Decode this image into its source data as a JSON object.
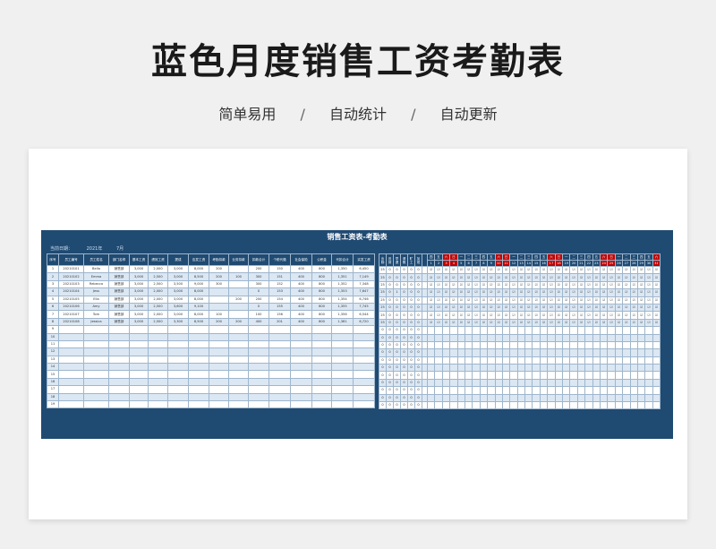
{
  "hero": {
    "title": "蓝色月度销售工资考勤表",
    "subtitle": [
      "简单易用",
      "自动统计",
      "自动更新"
    ],
    "separator": "/"
  },
  "sheet": {
    "title": "销售工资表-考勤表",
    "meta_label": "当前日期：",
    "year": "2021年",
    "month": "7月",
    "headers": [
      "序号",
      "员工编号",
      "员工姓名",
      "部门名称",
      "基本工资",
      "绩效工资",
      "提成",
      "应发工资",
      "考勤扣款",
      "业务扣款",
      "扣款合计",
      "个税代缴",
      "社会保险",
      "公积金",
      "代扣合计",
      "实发工资"
    ],
    "rows": [
      [
        "1",
        "20210101",
        "Bella",
        "销售部",
        "3,000",
        "2,000",
        "3,000",
        "8,000",
        "200",
        "",
        "200",
        "150",
        "400",
        "800",
        "1,350",
        "6,450"
      ],
      [
        "2",
        "20210102",
        "Emma",
        "销售部",
        "3,000",
        "2,500",
        "3,000",
        "8,500",
        "200",
        "100",
        "300",
        "151",
        "400",
        "800",
        "1,351",
        "7,149"
      ],
      [
        "3",
        "20210103",
        "Rebecca",
        "销售部",
        "3,000",
        "2,500",
        "3,500",
        "9,000",
        "300",
        "",
        "300",
        "152",
        "400",
        "800",
        "1,352",
        "7,348"
      ],
      [
        "4",
        "20210104",
        "Jess",
        "销售部",
        "3,000",
        "2,000",
        "3,000",
        "8,000",
        "",
        "",
        "0",
        "153",
        "400",
        "800",
        "1,353",
        "7,647"
      ],
      [
        "5",
        "20210105",
        "Ella",
        "销售部",
        "3,000",
        "2,000",
        "3,000",
        "8,000",
        "",
        "200",
        "200",
        "154",
        "400",
        "800",
        "1,354",
        "6,746"
      ],
      [
        "6",
        "20210106",
        "Amy",
        "销售部",
        "3,000",
        "2,500",
        "3,600",
        "9,100",
        "",
        "",
        "0",
        "155",
        "400",
        "800",
        "1,355",
        "7,745"
      ],
      [
        "7",
        "20210107",
        "Tom",
        "销售部",
        "3,000",
        "2,000",
        "3,000",
        "8,000",
        "100",
        "",
        "100",
        "156",
        "400",
        "800",
        "1,356",
        "6,544"
      ],
      [
        "8",
        "20210108",
        "Jessica",
        "销售部",
        "3,000",
        "2,500",
        "3,300",
        "8,500",
        "200",
        "200",
        "400",
        "201",
        "400",
        "800",
        "1,361",
        "6,720"
      ]
    ],
    "empty_rows": [
      "9",
      "10",
      "11",
      "12",
      "13",
      "14",
      "15",
      "16",
      "17",
      "18",
      "19"
    ],
    "summary_headers": [
      "出勤",
      "迟到",
      "早退",
      "请假",
      "旷工",
      "加班"
    ],
    "summary_rows": [
      [
        "25",
        "0",
        "0",
        "0",
        "0",
        "0"
      ],
      [
        "25",
        "0",
        "0",
        "0",
        "0",
        "0"
      ],
      [
        "25",
        "0",
        "0",
        "0",
        "0",
        "0"
      ],
      [
        "25",
        "0",
        "1",
        "0",
        "0",
        "0"
      ],
      [
        "25",
        "0",
        "0",
        "0",
        "0",
        "0"
      ],
      [
        "25",
        "0",
        "0",
        "0",
        "0",
        "0"
      ],
      [
        "25",
        "0",
        "0",
        "0",
        "0",
        "0"
      ],
      [
        "25",
        "0",
        "0",
        "0",
        "0",
        "0"
      ]
    ],
    "summary_empty": [
      "0",
      "0",
      "0",
      "0",
      "0",
      "0"
    ],
    "weekdays": [
      "四",
      "五",
      "六",
      "日",
      "一",
      "二",
      "三",
      "四",
      "五",
      "六",
      "日",
      "一",
      "二",
      "三",
      "四",
      "五",
      "六",
      "日",
      "一",
      "二",
      "三",
      "四",
      "五",
      "六",
      "日",
      "一",
      "二",
      "三",
      "四",
      "五",
      "六"
    ],
    "days": [
      "1",
      "2",
      "3",
      "4",
      "5",
      "6",
      "7",
      "8",
      "9",
      "10",
      "11",
      "12",
      "13",
      "14",
      "15",
      "16",
      "17",
      "18",
      "19",
      "20",
      "21",
      "22",
      "23",
      "24",
      "25",
      "26",
      "27",
      "28",
      "29",
      "30",
      "31"
    ],
    "mark": "☑",
    "colors": {
      "sheet_bg": "#1f4a72",
      "weekend": "#c00000",
      "stripe": "#dbe7f3"
    }
  }
}
